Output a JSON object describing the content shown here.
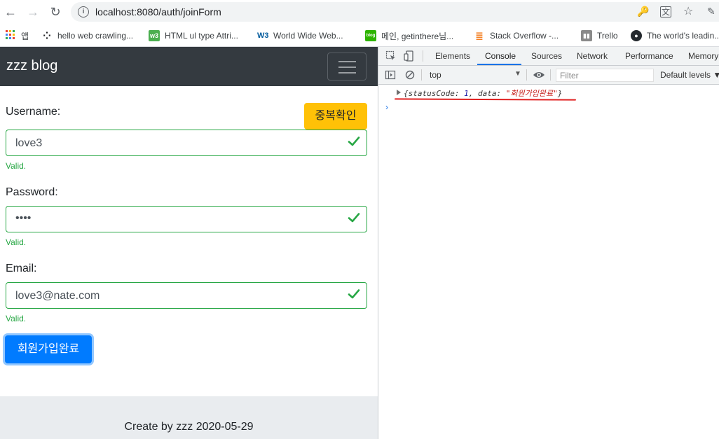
{
  "browser": {
    "url": "localhost:8080/auth/joinForm",
    "bookmarks": [
      {
        "label": "앱",
        "icon": "apps-grid-icon",
        "color": "#ea4335"
      },
      {
        "label": "hello web crawling...",
        "icon": "dots-icon",
        "color": "#202124"
      },
      {
        "label": "HTML ul type Attri...",
        "icon": "w3schools-icon",
        "color": "#4caf50"
      },
      {
        "label": "World Wide Web...",
        "icon": "w3c-icon",
        "color": "#005a9c"
      },
      {
        "label": "메인, getinthere님...",
        "icon": "blog-icon",
        "color": "#2db400"
      },
      {
        "label": "Stack Overflow -...",
        "icon": "stackoverflow-icon",
        "color": "#f48024"
      },
      {
        "label": "Trello",
        "icon": "trello-icon",
        "color": "#6b6b6b"
      },
      {
        "label": "The world's leadin...",
        "icon": "github-icon",
        "color": "#24292e"
      }
    ]
  },
  "page": {
    "brand": "zzz blog",
    "username_label": "Username:",
    "username_value": "love3",
    "dup_button": "중복확인",
    "password_label": "Password:",
    "password_value": "••••",
    "email_label": "Email:",
    "email_value": "love3@nate.com",
    "valid_text": "Valid.",
    "submit_button": "회원가입완료",
    "footer": "Create by zzz 2020-05-29"
  },
  "devtools": {
    "tabs": [
      "Elements",
      "Console",
      "Sources",
      "Network",
      "Performance",
      "Memory"
    ],
    "active_tab": "Console",
    "context": "top",
    "filter_placeholder": "Filter",
    "levels": "Default levels ▼",
    "log": {
      "open": "{",
      "k1": "statusCode: ",
      "v1": "1",
      "sep": ", ",
      "k2": "data: ",
      "v2": "\"회원가입완료\"",
      "close": "}"
    },
    "prompt": "›"
  },
  "colors": {
    "navbar": "#343a40",
    "valid": "#28a745",
    "warning_button": "#ffc107",
    "primary_button": "#007bff",
    "footer": "#e9ecef"
  }
}
